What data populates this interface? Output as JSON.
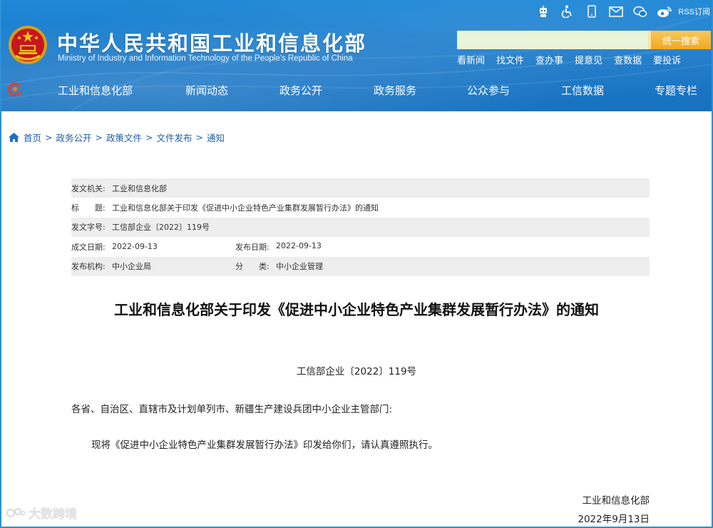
{
  "header": {
    "title": "中华人民共和国工业和信息化部",
    "subtitle": "Ministry of Industry and Information Technology of the People's Republic of China",
    "rss_label": "RSS订阅",
    "top_icons": [
      "robot-icon",
      "accessibility-icon",
      "mobile-icon",
      "mail-icon",
      "wechat-icon",
      "weibo-icon"
    ],
    "search": {
      "placeholder": "",
      "button_label": "统一搜索"
    },
    "quick_links": [
      "看新闻",
      "找文件",
      "查办事",
      "提意见",
      "查数据",
      "要投诉"
    ],
    "colors": {
      "header_blue": "#1b79c8",
      "search_button": "#f0a923",
      "search_box": "#e9f5d8"
    }
  },
  "nav": {
    "items": [
      "工业和信息化部",
      "新闻动态",
      "政务公开",
      "政务服务",
      "公众参与",
      "工信数据",
      "专题专栏"
    ]
  },
  "breadcrumb": [
    "首页",
    "政务公开",
    "政策文件",
    "文件发布",
    "通知"
  ],
  "meta": {
    "issuer_label": "发文机关:",
    "issuer": "工业和信息化部",
    "title_label": "标　　题:",
    "title": "工业和信息化部关于印发《促进中小企业特色产业集群发展暂行办法》的通知",
    "docno_label": "发文字号:",
    "docno": "工信部企业〔2022〕119号",
    "written_label": "成文日期:",
    "written": "2022-09-13",
    "published_label": "发布日期:",
    "published": "2022-09-13",
    "org_label": "发布机构:",
    "org": "中小企业局",
    "category_label": "分　　类:",
    "category": "中小企业管理"
  },
  "article": {
    "title": "工业和信息化部关于印发《促进中小企业特色产业集群发展暂行办法》的通知",
    "docno": "工信部企业〔2022〕119号",
    "addressee": "各省、自治区、直辖市及计划单列市、新疆生产建设兵团中小企业主管部门:",
    "body": "现将《促进中小企业特色产业集群发展暂行办法》印发给你们，请认真遵照执行。",
    "sign_org": "工业和信息化部",
    "sign_date": "2022年9月13日"
  },
  "watermark": "大数跨境"
}
